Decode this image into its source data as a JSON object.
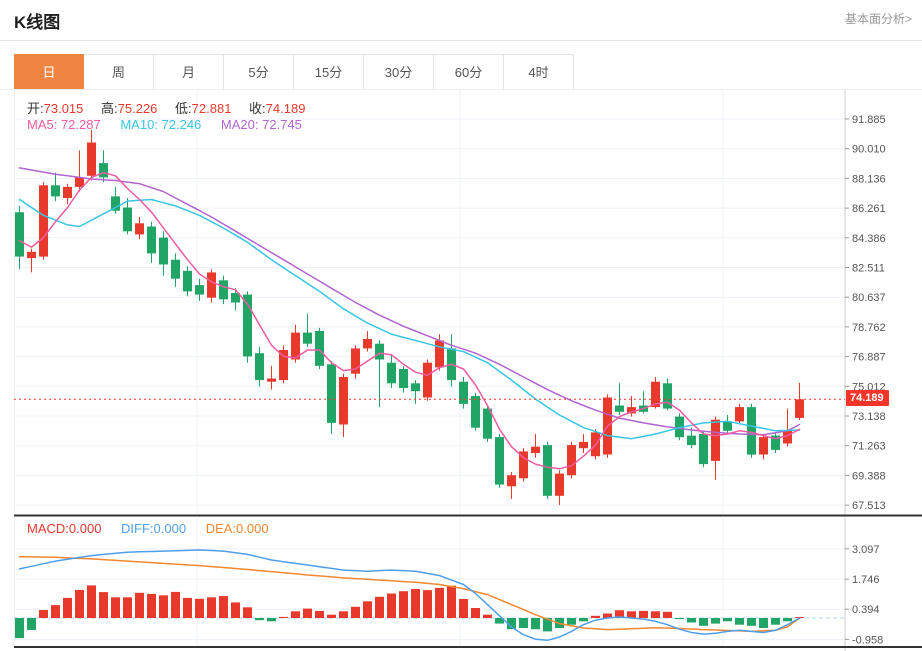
{
  "header": {
    "title": "K线图",
    "analysis_link": "基本面分析>"
  },
  "tabs": [
    {
      "label": "日",
      "selected": true
    },
    {
      "label": "周",
      "selected": false
    },
    {
      "label": "月",
      "selected": false
    },
    {
      "label": "5分",
      "selected": false
    },
    {
      "label": "15分",
      "selected": false
    },
    {
      "label": "30分",
      "selected": false
    },
    {
      "label": "60分",
      "selected": false
    },
    {
      "label": "4时",
      "selected": false
    }
  ],
  "ohlc_row": [
    {
      "label": "开:",
      "value": "73.015"
    },
    {
      "label": "高:",
      "value": "75.226"
    },
    {
      "label": "低:",
      "value": "72.881"
    },
    {
      "label": "收:",
      "value": "74.189"
    }
  ],
  "ma_row": {
    "ma5": "MA5: 72.287",
    "ma10": "MA10: 72.246",
    "ma20": "MA20: 72.745"
  },
  "macd_row": {
    "macd": "MACD:0.000",
    "diff": "DIFF:0.000",
    "dea": "DEA:0.000"
  },
  "price_marker": "74.189",
  "colors": {
    "up": "#e8392d",
    "down": "#21a567",
    "ma5": "#ef5ba1",
    "ma10": "#38c5e3",
    "ma20": "#b264cf",
    "diff": "#4f9fe8",
    "dea": "#f5872e",
    "grid": "#edf1f7",
    "axis_line": "#ccc",
    "axis_text": "#555",
    "zero_dash": "#a9d7ef",
    "pane_bottom": "#333",
    "price_line": "#f5352a",
    "tab_active_bg": "#ef8443"
  },
  "chart_data": {
    "type": "candlestick+macd",
    "main": {
      "y_ticks": [
        "91.885",
        "90.010",
        "88.136",
        "86.261",
        "84.386",
        "82.511",
        "80.637",
        "78.762",
        "76.887",
        "75.012",
        "73.138",
        "71.263",
        "69.388",
        "67.513"
      ],
      "last_price": 74.189,
      "candles": [
        [
          86.0,
          86.4,
          82.4,
          83.2
        ],
        [
          83.1,
          83.7,
          82.2,
          83.5
        ],
        [
          83.2,
          87.9,
          83.0,
          87.7
        ],
        [
          87.7,
          88.5,
          86.7,
          87.0
        ],
        [
          86.9,
          87.8,
          86.5,
          87.6
        ],
        [
          87.6,
          89.9,
          87.3,
          88.2
        ],
        [
          88.3,
          91.2,
          88.0,
          90.4
        ],
        [
          89.1,
          89.9,
          87.9,
          88.2
        ],
        [
          87.0,
          87.6,
          85.9,
          86.1
        ],
        [
          86.3,
          86.9,
          84.6,
          84.8
        ],
        [
          84.6,
          85.7,
          84.3,
          85.3
        ],
        [
          85.1,
          85.4,
          82.8,
          83.4
        ],
        [
          84.4,
          84.8,
          82.0,
          82.7
        ],
        [
          83.0,
          83.4,
          81.3,
          81.8
        ],
        [
          82.3,
          82.6,
          80.7,
          81.0
        ],
        [
          81.4,
          81.8,
          80.4,
          80.8
        ],
        [
          80.6,
          82.4,
          80.3,
          82.2
        ],
        [
          81.7,
          82.0,
          80.2,
          80.5
        ],
        [
          80.9,
          81.2,
          79.8,
          80.3
        ],
        [
          80.8,
          81.0,
          76.5,
          76.9
        ],
        [
          77.1,
          77.5,
          75.0,
          75.4
        ],
        [
          75.3,
          76.3,
          74.8,
          75.5
        ],
        [
          75.4,
          77.6,
          75.2,
          77.3
        ],
        [
          76.7,
          78.9,
          76.5,
          78.4
        ],
        [
          78.4,
          79.6,
          77.5,
          77.7
        ],
        [
          78.5,
          78.7,
          76.1,
          76.3
        ],
        [
          76.4,
          76.6,
          72.0,
          72.7
        ],
        [
          72.6,
          75.8,
          71.8,
          75.6
        ],
        [
          75.8,
          77.6,
          75.5,
          77.4
        ],
        [
          77.4,
          78.5,
          77.2,
          78.0
        ],
        [
          77.7,
          77.9,
          73.7,
          76.7
        ],
        [
          76.5,
          77.0,
          74.9,
          75.2
        ],
        [
          76.1,
          76.3,
          74.6,
          74.9
        ],
        [
          75.2,
          75.4,
          73.9,
          74.7
        ],
        [
          74.3,
          76.7,
          74.1,
          76.5
        ],
        [
          76.2,
          78.3,
          76.0,
          77.9
        ],
        [
          77.4,
          78.3,
          75.0,
          75.4
        ],
        [
          75.3,
          75.6,
          73.6,
          73.9
        ],
        [
          74.4,
          74.6,
          72.2,
          72.4
        ],
        [
          73.6,
          73.8,
          71.5,
          71.7
        ],
        [
          71.8,
          72.0,
          68.6,
          68.8
        ],
        [
          68.7,
          69.6,
          67.9,
          69.4
        ],
        [
          69.2,
          71.1,
          69.0,
          70.9
        ],
        [
          70.8,
          72.0,
          70.5,
          71.2
        ],
        [
          71.3,
          71.5,
          67.9,
          68.1
        ],
        [
          68.1,
          69.7,
          67.513,
          69.5
        ],
        [
          69.4,
          71.5,
          69.2,
          71.3
        ],
        [
          71.1,
          72.0,
          70.8,
          71.5
        ],
        [
          70.6,
          72.3,
          70.4,
          72.1
        ],
        [
          70.7,
          74.5,
          70.5,
          74.3
        ],
        [
          73.8,
          75.2,
          73.2,
          73.4
        ],
        [
          73.3,
          74.4,
          73.1,
          73.7
        ],
        [
          73.8,
          74.7,
          73.3,
          73.4
        ],
        [
          73.7,
          75.6,
          73.6,
          75.3
        ],
        [
          75.2,
          75.5,
          73.5,
          73.6
        ],
        [
          73.1,
          73.3,
          71.6,
          71.8
        ],
        [
          71.9,
          72.4,
          71.1,
          71.3
        ],
        [
          72.0,
          72.2,
          69.9,
          70.1
        ],
        [
          70.3,
          73.1,
          69.1,
          72.9
        ],
        [
          72.8,
          73.2,
          72.0,
          72.2
        ],
        [
          72.8,
          73.9,
          72.6,
          73.7
        ],
        [
          73.7,
          73.9,
          70.5,
          70.7
        ],
        [
          70.7,
          72.0,
          70.4,
          71.8
        ],
        [
          71.9,
          72.1,
          70.8,
          71.0
        ],
        [
          71.4,
          73.6,
          71.2,
          72.2
        ],
        [
          73.015,
          75.226,
          72.881,
          74.189
        ]
      ],
      "ma5_points": [
        [
          0,
          84.2
        ],
        [
          1,
          83.8
        ],
        [
          2,
          84.4
        ],
        [
          3,
          85.4
        ],
        [
          4,
          86.3
        ],
        [
          5,
          87.4
        ],
        [
          6,
          88.2
        ],
        [
          7,
          88.5
        ],
        [
          8,
          88.3
        ],
        [
          9,
          87.5
        ],
        [
          10,
          86.8
        ],
        [
          11,
          86.0
        ],
        [
          12,
          85.0
        ],
        [
          13,
          84.0
        ],
        [
          14,
          83.0
        ],
        [
          15,
          82.1
        ],
        [
          16,
          81.6
        ],
        [
          17,
          81.3
        ],
        [
          18,
          81.1
        ],
        [
          19,
          80.2
        ],
        [
          20,
          78.9
        ],
        [
          21,
          77.6
        ],
        [
          22,
          76.9
        ],
        [
          23,
          76.8
        ],
        [
          24,
          77.3
        ],
        [
          25,
          77.3
        ],
        [
          26,
          76.5
        ],
        [
          27,
          76.0
        ],
        [
          28,
          76.1
        ],
        [
          29,
          76.6
        ],
        [
          30,
          77.1
        ],
        [
          31,
          77.0
        ],
        [
          32,
          76.4
        ],
        [
          33,
          75.9
        ],
        [
          34,
          75.7
        ],
        [
          35,
          76.2
        ],
        [
          36,
          76.4
        ],
        [
          37,
          76.1
        ],
        [
          38,
          75.1
        ],
        [
          39,
          73.8
        ],
        [
          40,
          72.3
        ],
        [
          41,
          71.2
        ],
        [
          42,
          70.5
        ],
        [
          43,
          70.1
        ],
        [
          44,
          69.9
        ],
        [
          45,
          69.8
        ],
        [
          46,
          70.0
        ],
        [
          47,
          70.6
        ],
        [
          48,
          71.3
        ],
        [
          49,
          72.5
        ],
        [
          50,
          73.1
        ],
        [
          51,
          73.4
        ],
        [
          52,
          73.6
        ],
        [
          53,
          73.9
        ],
        [
          54,
          74.0
        ],
        [
          55,
          73.5
        ],
        [
          56,
          72.7
        ],
        [
          57,
          72.0
        ],
        [
          58,
          71.9
        ],
        [
          59,
          72.0
        ],
        [
          60,
          72.2
        ],
        [
          61,
          72.1
        ],
        [
          62,
          71.9
        ],
        [
          63,
          71.7
        ],
        [
          64,
          71.9
        ],
        [
          65,
          72.287
        ]
      ],
      "ma10_points": [
        [
          0,
          86.8
        ],
        [
          2,
          85.8
        ],
        [
          4,
          85.2
        ],
        [
          5,
          85.1
        ],
        [
          7,
          85.9
        ],
        [
          9,
          86.7
        ],
        [
          11,
          86.8
        ],
        [
          13,
          86.4
        ],
        [
          15,
          85.8
        ],
        [
          17,
          85.0
        ],
        [
          19,
          84.1
        ],
        [
          21,
          83.0
        ],
        [
          23,
          82.0
        ],
        [
          25,
          81.0
        ],
        [
          27,
          79.9
        ],
        [
          29,
          79.0
        ],
        [
          31,
          78.3
        ],
        [
          33,
          77.9
        ],
        [
          35,
          77.5
        ],
        [
          37,
          77.2
        ],
        [
          39,
          76.5
        ],
        [
          41,
          75.4
        ],
        [
          43,
          74.2
        ],
        [
          45,
          73.2
        ],
        [
          47,
          72.4
        ],
        [
          49,
          71.9
        ],
        [
          51,
          71.7
        ],
        [
          53,
          72.0
        ],
        [
          55,
          72.4
        ],
        [
          57,
          72.7
        ],
        [
          59,
          72.8
        ],
        [
          61,
          72.5
        ],
        [
          63,
          72.2
        ],
        [
          65,
          72.246
        ]
      ],
      "ma20_points": [
        [
          0,
          88.8
        ],
        [
          3,
          88.4
        ],
        [
          6,
          88.1
        ],
        [
          8,
          88.0
        ],
        [
          10,
          87.8
        ],
        [
          12,
          87.3
        ],
        [
          14,
          86.5
        ],
        [
          16,
          85.7
        ],
        [
          18,
          84.8
        ],
        [
          20,
          83.9
        ],
        [
          22,
          83.0
        ],
        [
          24,
          82.1
        ],
        [
          26,
          81.2
        ],
        [
          28,
          80.3
        ],
        [
          30,
          79.5
        ],
        [
          32,
          78.8
        ],
        [
          34,
          78.2
        ],
        [
          36,
          77.6
        ],
        [
          38,
          77.1
        ],
        [
          40,
          76.4
        ],
        [
          42,
          75.6
        ],
        [
          44,
          74.8
        ],
        [
          46,
          74.1
        ],
        [
          48,
          73.5
        ],
        [
          50,
          73.0
        ],
        [
          52,
          72.7
        ],
        [
          54,
          72.45
        ],
        [
          56,
          72.25
        ],
        [
          58,
          72.1
        ],
        [
          60,
          72.0
        ],
        [
          62,
          71.95
        ],
        [
          64,
          72.2
        ],
        [
          65,
          72.6
        ]
      ]
    },
    "macd": {
      "y_ticks": [
        "3.097",
        "1.746",
        "0.394",
        "-0.958"
      ],
      "histogram": [
        -0.9,
        -0.54,
        0.36,
        0.58,
        0.9,
        1.26,
        1.46,
        1.16,
        0.93,
        0.93,
        1.13,
        1.08,
        1.02,
        1.17,
        0.9,
        0.86,
        0.93,
        0.98,
        0.7,
        0.48,
        -0.1,
        -0.15,
        0.05,
        0.3,
        0.42,
        0.32,
        0.15,
        0.3,
        0.5,
        0.75,
        0.95,
        1.1,
        1.2,
        1.3,
        1.25,
        1.35,
        1.45,
        0.85,
        0.45,
        0.15,
        -0.25,
        -0.5,
        -0.45,
        -0.5,
        -0.6,
        -0.45,
        -0.3,
        -0.15,
        0.1,
        0.2,
        0.35,
        0.3,
        0.32,
        0.3,
        0.28,
        -0.05,
        -0.2,
        -0.35,
        -0.25,
        -0.15,
        -0.3,
        -0.35,
        -0.45,
        -0.3,
        -0.15,
        0.0
      ],
      "diff_points": [
        [
          0,
          2.2
        ],
        [
          3,
          2.55
        ],
        [
          6,
          2.8
        ],
        [
          9,
          2.95
        ],
        [
          12,
          3.0
        ],
        [
          15,
          3.05
        ],
        [
          17,
          3.0
        ],
        [
          19,
          2.85
        ],
        [
          21,
          2.6
        ],
        [
          23,
          2.45
        ],
        [
          25,
          2.3
        ],
        [
          27,
          2.15
        ],
        [
          29,
          2.1
        ],
        [
          31,
          2.15
        ],
        [
          33,
          2.1
        ],
        [
          35,
          1.9
        ],
        [
          37,
          1.5
        ],
        [
          38,
          1.1
        ],
        [
          39,
          0.6
        ],
        [
          40,
          0.1
        ],
        [
          41,
          -0.4
        ],
        [
          42,
          -0.75
        ],
        [
          43,
          -0.95
        ],
        [
          44,
          -1.0
        ],
        [
          45,
          -0.85
        ],
        [
          46,
          -0.6
        ],
        [
          47,
          -0.3
        ],
        [
          48,
          -0.1
        ],
        [
          49,
          0.0
        ],
        [
          50,
          0.05
        ],
        [
          51,
          0.0
        ],
        [
          52,
          -0.05
        ],
        [
          53,
          -0.15
        ],
        [
          54,
          -0.3
        ],
        [
          55,
          -0.5
        ],
        [
          56,
          -0.65
        ],
        [
          57,
          -0.72
        ],
        [
          58,
          -0.68
        ],
        [
          59,
          -0.6
        ],
        [
          60,
          -0.55
        ],
        [
          61,
          -0.6
        ],
        [
          62,
          -0.65
        ],
        [
          63,
          -0.55
        ],
        [
          64,
          -0.3
        ],
        [
          65,
          0.0
        ]
      ],
      "dea_points": [
        [
          0,
          2.75
        ],
        [
          3,
          2.72
        ],
        [
          6,
          2.65
        ],
        [
          9,
          2.55
        ],
        [
          12,
          2.45
        ],
        [
          15,
          2.35
        ],
        [
          18,
          2.22
        ],
        [
          21,
          2.08
        ],
        [
          24,
          1.93
        ],
        [
          27,
          1.8
        ],
        [
          30,
          1.7
        ],
        [
          33,
          1.6
        ],
        [
          35,
          1.5
        ],
        [
          37,
          1.32
        ],
        [
          39,
          1.05
        ],
        [
          41,
          0.6
        ],
        [
          43,
          0.15
        ],
        [
          45,
          -0.25
        ],
        [
          47,
          -0.45
        ],
        [
          49,
          -0.52
        ],
        [
          51,
          -0.48
        ],
        [
          53,
          -0.44
        ],
        [
          55,
          -0.47
        ],
        [
          57,
          -0.52
        ],
        [
          59,
          -0.56
        ],
        [
          61,
          -0.6
        ],
        [
          63,
          -0.55
        ],
        [
          64,
          -0.4
        ],
        [
          65,
          0.0
        ]
      ]
    }
  }
}
